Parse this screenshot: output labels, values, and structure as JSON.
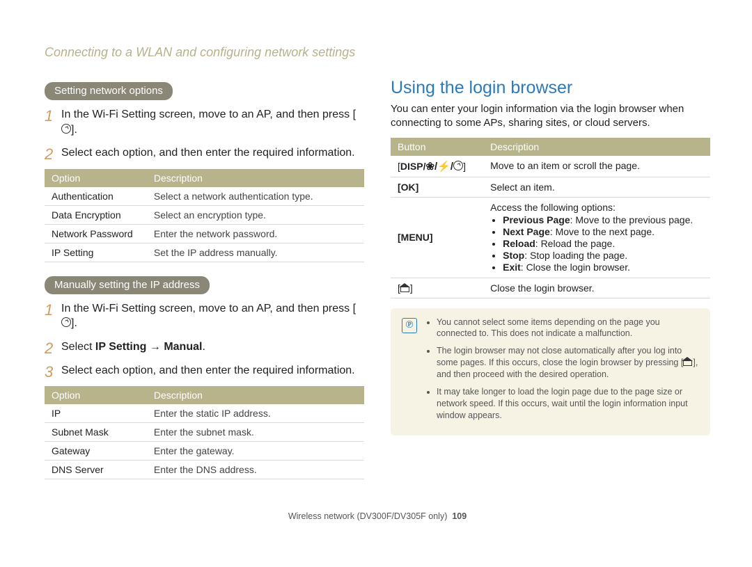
{
  "breadcrumb": "Connecting to a WLAN and configuring network settings",
  "left": {
    "section1": {
      "heading": "Setting network options",
      "steps": [
        {
          "pre": "In the Wi-Fi Setting screen, move to an AP, and then press [",
          "icon": "timer-icon",
          "post": "]."
        },
        {
          "text": "Select each option, and then enter the required information."
        }
      ],
      "table_head_option": "Option",
      "table_head_desc": "Description",
      "rows": [
        {
          "opt": "Authentication",
          "desc": "Select a network authentication type."
        },
        {
          "opt": "Data Encryption",
          "desc": "Select an encryption type."
        },
        {
          "opt": "Network Password",
          "desc": "Enter the network password."
        },
        {
          "opt": "IP Setting",
          "desc": "Set the IP address manually."
        }
      ]
    },
    "section2": {
      "heading": "Manually setting the IP address",
      "steps": [
        {
          "pre": "In the Wi-Fi Setting screen, move to an AP, and then press [",
          "icon": "timer-icon",
          "post": "]."
        },
        {
          "pre": "Select ",
          "b1": "IP Setting",
          "arrow": " → ",
          "b2": "Manual",
          "post": "."
        },
        {
          "text": "Select each option, and then enter the required information."
        }
      ],
      "table_head_option": "Option",
      "table_head_desc": "Description",
      "rows": [
        {
          "opt": "IP",
          "desc": "Enter the static IP address."
        },
        {
          "opt": "Subnet Mask",
          "desc": "Enter the subnet mask."
        },
        {
          "opt": "Gateway",
          "desc": "Enter the gateway."
        },
        {
          "opt": "DNS Server",
          "desc": "Enter the DNS address."
        }
      ]
    }
  },
  "right": {
    "title": "Using the login browser",
    "intro": "You can enter your login information via the login browser when connecting to some APs, sharing sites, or cloud servers.",
    "table_head_button": "Button",
    "table_head_desc": "Description",
    "rows": [
      {
        "btn_prefix": "[",
        "btn_b": "DISP/",
        "btn_sym": "icons",
        "btn_suffix": "]",
        "desc": "Move to an item or scroll the page."
      },
      {
        "btn": "[OK]",
        "desc": "Select an item."
      },
      {
        "btn": "[MENU]",
        "desc_lead": "Access the following options:",
        "bullets": [
          {
            "b": "Previous Page",
            "t": ": Move to the previous page."
          },
          {
            "b": "Next Page",
            "t": ": Move to the next page."
          },
          {
            "b": "Reload",
            "t": ": Reload the page."
          },
          {
            "b": "Stop",
            "t": ": Stop loading the page."
          },
          {
            "b": "Exit",
            "t": ": Close the login browser."
          }
        ]
      },
      {
        "btn_icon": "home-icon",
        "desc": "Close the login browser."
      }
    ],
    "notes": [
      {
        "t": "You cannot select some items depending on the page you connected to. This does not indicate a malfunction."
      },
      {
        "pre": "The login browser may not close automatically after you log into some pages. If this occurs, close the login browser by pressing [",
        "icon": "home-icon",
        "post": "], and then proceed with the desired operation."
      },
      {
        "t": "It may take longer to load the login page due to the page size or network speed. If this occurs, wait until the login information input window appears."
      }
    ]
  },
  "footer": {
    "label": "Wireless network (DV300F/DV305F only)",
    "page": "109"
  }
}
